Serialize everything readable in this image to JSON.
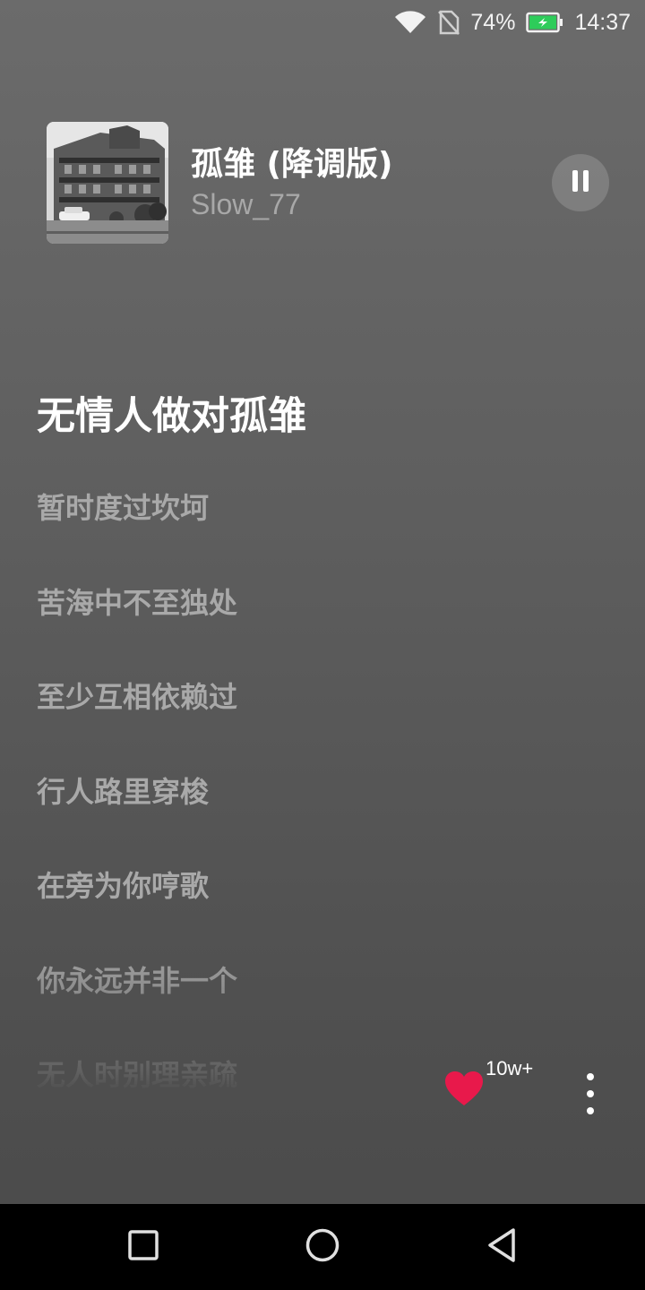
{
  "status_bar": {
    "battery_percent": "74%",
    "time": "14:37",
    "icons": [
      "wifi-icon",
      "no-sim-icon",
      "battery-charging-icon"
    ]
  },
  "now_playing": {
    "title": "孤雏 (降调版)",
    "artist": "Slow_77",
    "state": "playing",
    "control_icon": "pause-icon"
  },
  "lyrics": {
    "current": "无情人做对孤雏",
    "lines": [
      "暂时度过坎坷",
      "苦海中不至独处",
      "至少互相依赖过",
      "行人路里穿梭",
      "在旁为你哼歌",
      "你永远并非一个",
      "无人时别理亲疏"
    ]
  },
  "actions": {
    "like_count": "10w+",
    "like_icon": "heart-icon",
    "more_icon": "more-vertical-icon",
    "accent_color": "#e8194b"
  },
  "nav_bar": {
    "icons": [
      "recent-apps-icon",
      "home-icon",
      "back-icon"
    ]
  }
}
